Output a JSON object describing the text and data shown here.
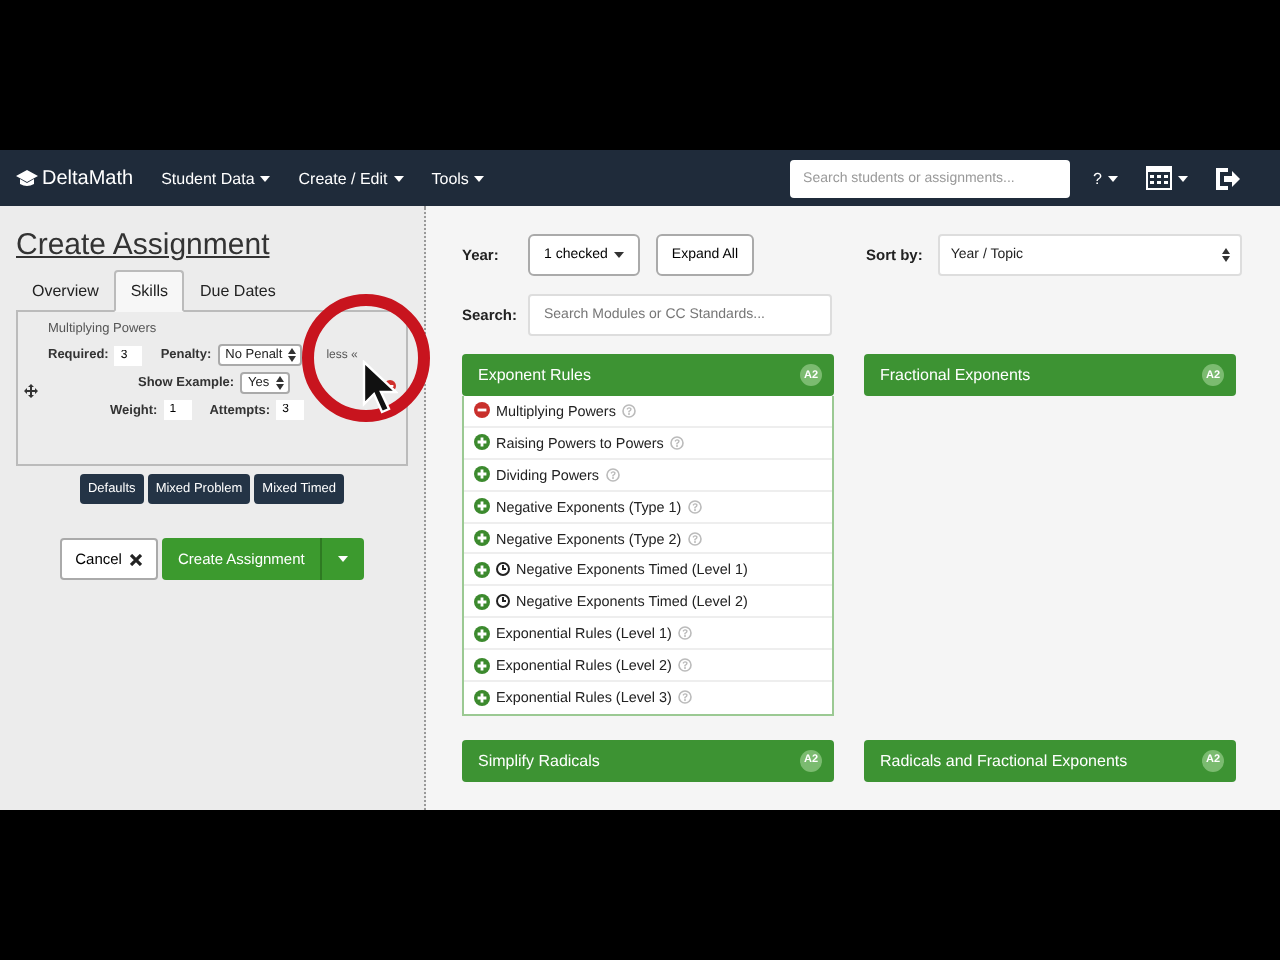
{
  "navbar": {
    "brand": "DeltaMath",
    "menus": [
      {
        "label": "Student Data"
      },
      {
        "label": "Create / Edit"
      },
      {
        "label": "Tools"
      }
    ],
    "search": {
      "placeholder": "Search students or assignments..."
    },
    "help": "?"
  },
  "assignment": {
    "title": "Create Assignment",
    "tabs": [
      {
        "label": "Overview",
        "selected": false
      },
      {
        "label": "Skills",
        "selected": true
      },
      {
        "label": "Due Dates",
        "selected": false
      }
    ],
    "skill": {
      "name": "Multiplying Powers",
      "required_label": "Required:",
      "required": "3",
      "penalty_label": "Penalty:",
      "penalty": "No Penalt",
      "less": "less «",
      "show_example_label": "Show Example:",
      "show_example": "Yes",
      "weight_label": "Weight:",
      "weight": "1",
      "attempts_label": "Attempts:",
      "attempts": "3"
    },
    "presets": [
      "Defaults",
      "Mixed Problem",
      "Mixed Timed"
    ],
    "cancel": "Cancel",
    "create": "Create Assignment"
  },
  "filters": {
    "year_label": "Year:",
    "year": "1 checked",
    "expand": "Expand All",
    "sort_label": "Sort by:",
    "sort": "Year / Topic",
    "search_label": "Search:",
    "search_placeholder": "Search Modules or CC Standards..."
  },
  "modules": [
    {
      "title": "Exponent Rules",
      "badge": "A2",
      "expanded": true,
      "skills": [
        {
          "name": "Multiplying Powers",
          "added": true,
          "timed": false,
          "help": true
        },
        {
          "name": "Raising Powers to Powers",
          "added": false,
          "timed": false,
          "help": true
        },
        {
          "name": "Dividing Powers",
          "added": false,
          "timed": false,
          "help": true
        },
        {
          "name": "Negative Exponents (Type 1)",
          "added": false,
          "timed": false,
          "help": true
        },
        {
          "name": "Negative Exponents (Type 2)",
          "added": false,
          "timed": false,
          "help": true
        },
        {
          "name": "Negative Exponents Timed (Level 1)",
          "added": false,
          "timed": true,
          "help": false
        },
        {
          "name": "Negative Exponents Timed (Level 2)",
          "added": false,
          "timed": true,
          "help": false
        },
        {
          "name": "Exponential Rules (Level 1)",
          "added": false,
          "timed": false,
          "help": true
        },
        {
          "name": "Exponential Rules (Level 2)",
          "added": false,
          "timed": false,
          "help": true
        },
        {
          "name": "Exponential Rules (Level 3)",
          "added": false,
          "timed": false,
          "help": true
        }
      ]
    },
    {
      "title": "Fractional Exponents",
      "badge": "A2",
      "expanded": false
    },
    {
      "title": "Simplify Radicals",
      "badge": "A2",
      "expanded": false
    },
    {
      "title": "Radicals and Fractional Exponents",
      "badge": "A2",
      "expanded": false
    }
  ]
}
